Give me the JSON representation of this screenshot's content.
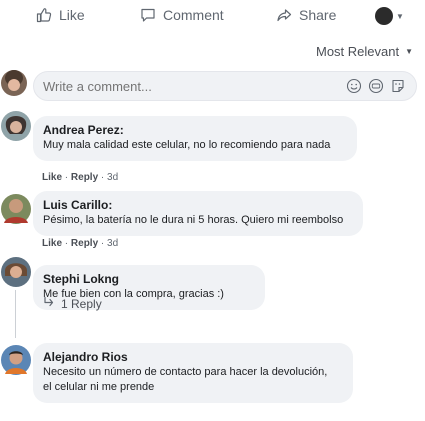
{
  "actions": {
    "like": "Like",
    "comment": "Comment",
    "share": "Share"
  },
  "sort": {
    "label": "Most Relevant"
  },
  "composer": {
    "placeholder": "Write a comment..."
  },
  "comments": [
    {
      "author": "Andrea Perez:",
      "text": "Muy mala calidad este celular, no lo recomiendo para nada",
      "like": "Like",
      "reply": "Reply",
      "time": "3d"
    },
    {
      "author": "Luis Carillo:",
      "text": "Pésimo, la batería no le dura ni 5 horas. Quiero mi reembolso",
      "like": "Like",
      "reply": "Reply",
      "time": "3d"
    },
    {
      "author": "Stephi Lokng",
      "text": "Me fue bien con la compra, gracias :)"
    },
    {
      "author": "Alejandro Rios",
      "text_line1": "Necesito un número de contacto para hacer la devolución,",
      "text_line2": "el celular ni me prende"
    }
  ],
  "replies": {
    "label": "1 Reply"
  },
  "colors": {
    "bubble": "#f0f2f5",
    "secondary_text": "#606770",
    "primary_text": "#1c1e21"
  }
}
